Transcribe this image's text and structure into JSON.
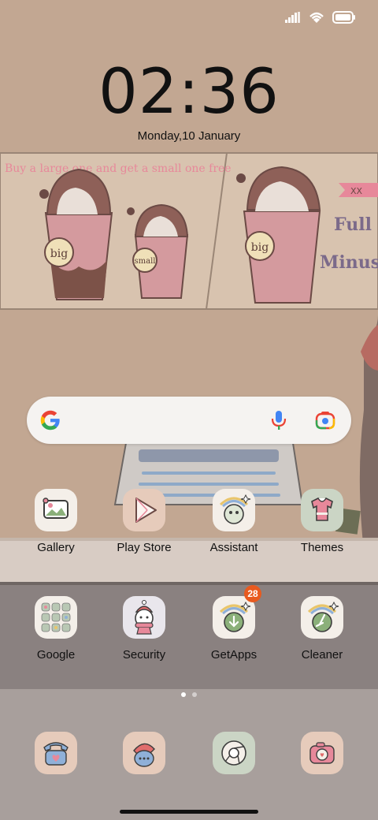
{
  "status_bar": {
    "signal_icon": "signal-icon",
    "wifi_icon": "wifi-icon",
    "battery_icon": "battery-icon"
  },
  "lockscreen": {
    "time": "02:36",
    "date": "Monday,10 January"
  },
  "wallpaper": {
    "banner_text": "Buy a large one and get a small one free",
    "cup_big_label": "big",
    "cup_small_label": "small",
    "cup_right_label": "big",
    "sign_full": "Full",
    "sign_minus": "Minus",
    "sign_tag": "XX"
  },
  "search_bar": {
    "google_icon": "google-g-icon",
    "mic_icon": "microphone-icon",
    "lens_icon": "google-lens-icon"
  },
  "apps_row1": [
    {
      "label": "Gallery",
      "icon": "gallery-icon"
    },
    {
      "label": "Play Store",
      "icon": "play-store-icon"
    },
    {
      "label": "Assistant",
      "icon": "assistant-icon"
    },
    {
      "label": "Themes",
      "icon": "themes-icon"
    }
  ],
  "apps_row2": [
    {
      "label": "Google",
      "icon": "google-folder-icon"
    },
    {
      "label": "Security",
      "icon": "security-icon"
    },
    {
      "label": "GetApps",
      "icon": "getapps-icon",
      "badge": "28"
    },
    {
      "label": "Cleaner",
      "icon": "cleaner-icon"
    }
  ],
  "dock": [
    {
      "icon": "phone-icon"
    },
    {
      "icon": "messages-icon"
    },
    {
      "icon": "chrome-icon"
    },
    {
      "icon": "camera-icon"
    }
  ],
  "page_indicator": {
    "pages": 2,
    "current": 1
  },
  "colors": {
    "wall": "#c3a894",
    "shelf": "#efe7e0",
    "counter": "#8a8080",
    "dock_bg": "#a89f9c",
    "badge": "#e85a1f"
  }
}
